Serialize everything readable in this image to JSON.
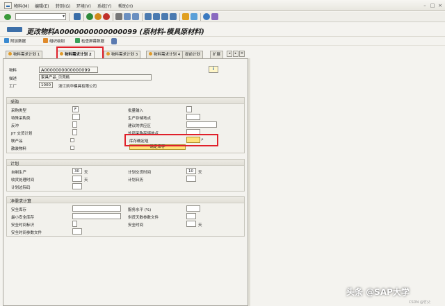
{
  "menu": {
    "items": [
      "物料(M)",
      "编辑(E)",
      "转到(G)",
      "环境(V)",
      "系统(Y)",
      "帮助(H)"
    ]
  },
  "toolbar": {
    "command_value": ""
  },
  "title": "更改物料A0000000000000099 (原材料-模具原材料)",
  "app_toolbar": {
    "additional_data": "附加数据",
    "org_levels": "组织级别",
    "check_screen_data": "检查屏幕数据"
  },
  "tabs": [
    {
      "label": "物料需求计划 1",
      "active": false
    },
    {
      "label": "物料需求计划 2",
      "active": true
    },
    {
      "label": "物料需求计划 3",
      "active": false
    },
    {
      "label": "物料需求计划 4",
      "active": false
    },
    {
      "label": "提前计划",
      "active": false
    },
    {
      "label": "扩展",
      "active": false
    }
  ],
  "header": {
    "material_label": "物料",
    "material_value": "A0000000000000099",
    "desc_label": "描述",
    "desc_value": "家具产品_贝壳桃",
    "plant_label": "工厂",
    "plant_value": "1000",
    "plant_name": "浙江凯华模具有限公司",
    "info_icon": "i"
  },
  "procurement": {
    "title": "采购",
    "proc_type_label": "采购类型",
    "proc_type_value": "F",
    "special_proc_label": "特殊采购类",
    "backflush_label": "反冲",
    "jit_label": "JIT 交货计划",
    "coproduct_label": "联产品",
    "bulk_label": "散装物料",
    "batch_entry_label": "批量输入",
    "prod_stor_label": "生产存储地点",
    "supply_area_label": "建议的供应区",
    "ext_stor_label": "外部采购存储地点",
    "stock_det_label": "库存确定组",
    "stock_det_button": "确定库存"
  },
  "scheduling": {
    "title": "计划",
    "inhouse_label": "自制生产",
    "inhouse_value": "30",
    "inhouse_unit": "天",
    "gr_time_label": "收货处理时间",
    "gr_time_unit": "天",
    "margin_key_label": "计划边际码",
    "planned_del_label": "计划交货时间",
    "planned_del_value": "10",
    "planned_del_unit": "天",
    "calendar_label": "计划日历"
  },
  "net_req": {
    "title": "净需求计算",
    "safety_stock_label": "安全库存",
    "min_safety_label": "最小安全库存",
    "safety_time_ind_label": "安全时间标识",
    "safety_period_label": "安全时间参数文件",
    "service_level_label": "服务水平 (%)",
    "coverage_label": "供货天数参数文件",
    "safety_time_label": "安全时间",
    "safety_time_unit": "天"
  },
  "watermark": {
    "main": "头条 @SAP大学",
    "sub": "CSDN @竹父"
  }
}
